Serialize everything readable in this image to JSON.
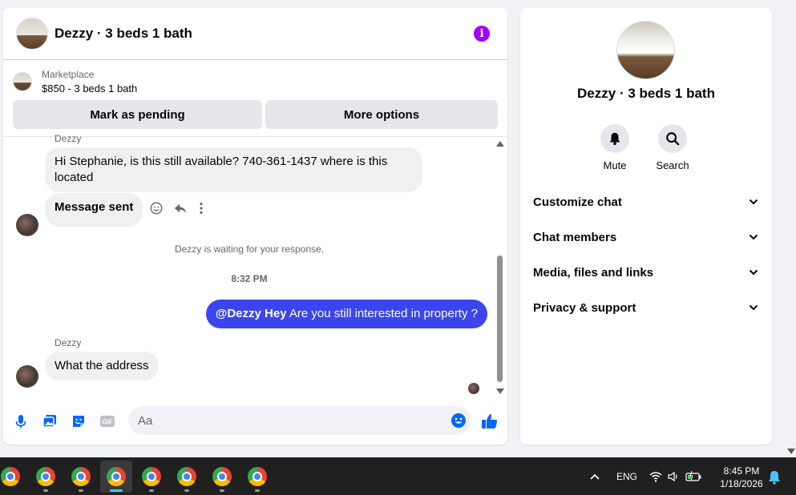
{
  "header": {
    "title": "Dezzy · 3 beds 1 bath"
  },
  "listing": {
    "source": "Marketplace",
    "price_line": "$850 - 3 beds 1 bath"
  },
  "actions": {
    "mark_pending": "Mark as pending",
    "more_options": "More options"
  },
  "messages": {
    "sender_top": "Dezzy",
    "incoming_1": "Hi Stephanie, is this still available? 740-361-1437 where is this located",
    "incoming_2": "Message sent",
    "waiting_notice": "Dezzy is waiting for your response.",
    "timestamp": "8:32 PM",
    "outgoing_mention": "@Dezzy Hey",
    "outgoing_text": " Are you still interested in property ?",
    "sender_bottom": "Dezzy",
    "incoming_3": "What the address"
  },
  "composer": {
    "placeholder": "Aa",
    "gif_label": "GIF"
  },
  "side_panel": {
    "title": "Dezzy · 3 beds 1 bath",
    "mute_label": "Mute",
    "search_label": "Search",
    "menu": [
      "Customize chat",
      "Chat members",
      "Media, files and links",
      "Privacy & support"
    ]
  },
  "taskbar": {
    "language": "ENG",
    "time": "8:45 PM",
    "date": "1/18/2026"
  },
  "colors": {
    "accent": "#0866ff",
    "outgoing_bubble": "#3a45ef",
    "info_icon": "#a200ff"
  }
}
